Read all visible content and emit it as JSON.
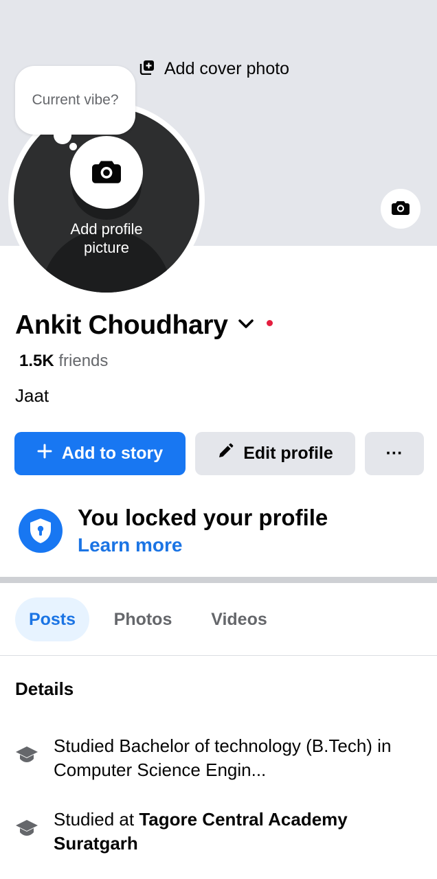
{
  "cover": {
    "add_cover_label": "Add cover photo"
  },
  "profile_picture": {
    "prompt": "Current vibe?",
    "add_label": "Add profile picture"
  },
  "user": {
    "name": "Ankit Choudhary",
    "friends_count": "1.5K",
    "friends_label": " friends",
    "bio": "Jaat"
  },
  "actions": {
    "add_story_label": "Add to story",
    "edit_profile_label": "Edit profile",
    "more_label": "···"
  },
  "lock_notice": {
    "title": "You locked your profile",
    "link": "Learn more"
  },
  "tabs": [
    {
      "label": "Posts",
      "selected": true
    },
    {
      "label": "Photos",
      "selected": false
    },
    {
      "label": "Videos",
      "selected": false
    }
  ],
  "details": {
    "title": "Details",
    "items": [
      {
        "icon": "graduation-cap-icon",
        "text": "Studied Bachelor of technology (B.Tech) in  Computer Science Engin...",
        "prefix": "",
        "bold": ""
      },
      {
        "icon": "graduation-cap-icon",
        "text": "",
        "prefix": "Studied at ",
        "bold": "Tagore Central Academy Suratgarh"
      }
    ]
  },
  "colors": {
    "accent": "#1877f2",
    "link": "#1b74e4",
    "cover": "#e4e6eb",
    "notification_dot": "#e41e3f"
  }
}
